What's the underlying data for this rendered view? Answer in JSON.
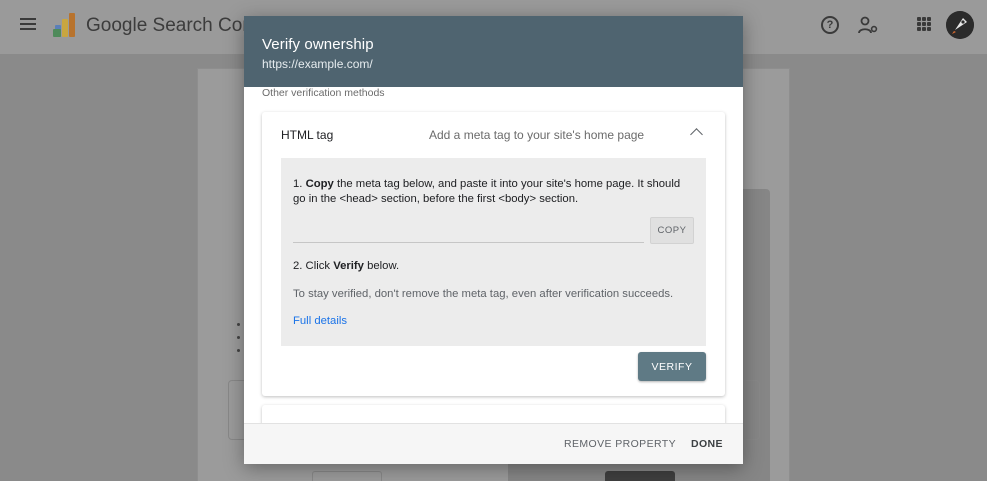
{
  "app": {
    "title": "Google Search Conso",
    "help_icon": "help-circle-icon",
    "account_icon": "manage-accounts-icon",
    "apps_icon": "apps-grid-icon",
    "avatar_icon": "rocket-avatar-icon"
  },
  "dialog": {
    "title": "Verify ownership",
    "subtitle": "https://example.com/",
    "section_label": "Other verification methods",
    "header_color": "#4f6470",
    "method": {
      "name": "HTML tag",
      "description": "Add a meta tag to your site's home page",
      "expanded": true,
      "step1_prefix": "1. ",
      "step1_bold": "Copy",
      "step1_rest": " the meta tag below, and paste it into your site's home page. It should go in the <head> section, before the first <body> section.",
      "meta_tag_value": "",
      "copy_label": "COPY",
      "step2_prefix": "2. Click ",
      "step2_bold": "Verify",
      "step2_rest": " below.",
      "stay_verified": "To stay verified, don't remove the meta tag, even after verification succeeds.",
      "full_details_label": "Full details",
      "verify_label": "VERIFY"
    },
    "footer": {
      "remove_label": "REMOVE PROPERTY",
      "done_label": "DONE"
    }
  },
  "colors": {
    "accent_link": "#1a73e8",
    "verify_button": "#5f7a85"
  }
}
